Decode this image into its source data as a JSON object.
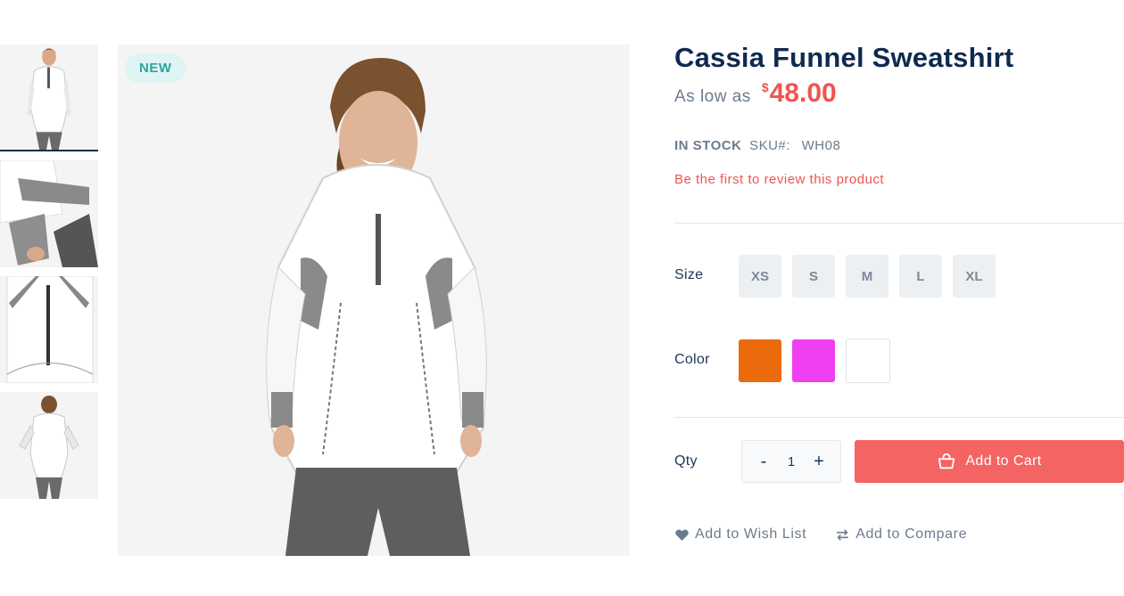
{
  "product": {
    "badge": "NEW",
    "title": "Cassia Funnel Sweatshirt",
    "price_prefix": "As low as",
    "currency_symbol": "$",
    "price": "48.00",
    "stock_status": "IN STOCK",
    "sku_label": "SKU#:",
    "sku": "WH08",
    "review_link": "Be the first to review this product"
  },
  "thumbnails": [
    {
      "icon": "product-front-thumbnail"
    },
    {
      "icon": "product-sleeve-detail-thumbnail"
    },
    {
      "icon": "product-zipper-detail-thumbnail"
    },
    {
      "icon": "product-back-thumbnail"
    }
  ],
  "options": {
    "size_label": "Size",
    "sizes": [
      "XS",
      "S",
      "M",
      "L",
      "XL"
    ],
    "color_label": "Color",
    "colors": [
      "#eb6a0b",
      "#ef3ff1",
      "#ffffff"
    ]
  },
  "cart": {
    "qty_label": "Qty",
    "minus": "-",
    "plus": "+",
    "qty_value": "1",
    "add_to_cart": "Add to Cart"
  },
  "actions": {
    "wishlist": "Add to Wish List",
    "compare": "Add to Compare"
  },
  "colors": {
    "accent": "#f46462",
    "price": "#f0544f",
    "title": "#0f2a50",
    "badge_bg": "#dff4f4",
    "badge_text": "#2aa6a0"
  }
}
